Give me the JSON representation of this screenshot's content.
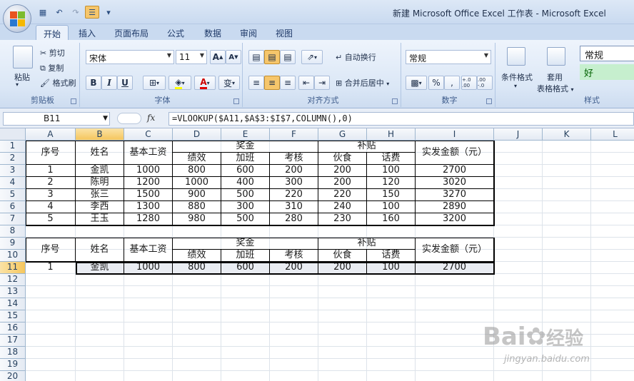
{
  "window": {
    "title": "新建 Microsoft Office Excel 工作表 - Microsoft Excel"
  },
  "tabs": [
    "开始",
    "插入",
    "页面布局",
    "公式",
    "数据",
    "审阅",
    "视图"
  ],
  "ribbon": {
    "clipboard": {
      "label": "剪贴板",
      "paste": "粘贴",
      "cut": "剪切",
      "copy": "复制",
      "format_painter": "格式刷"
    },
    "font": {
      "label": "字体",
      "name": "宋体",
      "size": "11",
      "bold": "B",
      "italic": "I",
      "underline": "U",
      "grow": "A",
      "shrink": "A",
      "font_color": "A",
      "phonetic": "变"
    },
    "alignment": {
      "label": "对齐方式",
      "wrap": "自动换行",
      "merge": "合并后居中"
    },
    "number": {
      "label": "数字",
      "format": "常规",
      "percent": "%",
      "comma": ",",
      "inc_decimal": "+.0 .00",
      "dec_decimal": ".00 -.0"
    },
    "styles": {
      "label": "样式",
      "conditional": "条件格式",
      "table_format_1": "套用",
      "table_format_2": "表格格式",
      "normal": "常规",
      "good": "好"
    },
    "colors": {
      "good_bg": "#c6efce",
      "good_fg": "#006100"
    }
  },
  "formula_bar": {
    "name_box": "B11",
    "fx": "fx",
    "formula": "=VLOOKUP($A11,$A$3:$I$7,COLUMN(),0)"
  },
  "columns": [
    "A",
    "B",
    "C",
    "D",
    "E",
    "F",
    "G",
    "H",
    "I",
    "J",
    "K",
    "L"
  ],
  "rows": [
    "1",
    "2",
    "3",
    "4",
    "5",
    "6",
    "7",
    "8",
    "9",
    "10",
    "11",
    "12",
    "13",
    "14",
    "15",
    "16",
    "17",
    "18",
    "19",
    "20"
  ],
  "table1": {
    "h_seq": "序号",
    "h_name": "姓名",
    "h_base": "基本工资",
    "h_bonus": "奖金",
    "h_perf": "绩效",
    "h_ot": "加班",
    "h_eval": "考核",
    "h_allow": "补贴",
    "h_meal": "伙食",
    "h_phone": "话费",
    "h_total": "实发金额（元）",
    "rows": [
      [
        "1",
        "金凯",
        "1000",
        "800",
        "600",
        "200",
        "200",
        "100",
        "2700"
      ],
      [
        "2",
        "陈明",
        "1200",
        "1000",
        "400",
        "300",
        "200",
        "120",
        "3020"
      ],
      [
        "3",
        "张三",
        "1500",
        "900",
        "500",
        "220",
        "220",
        "150",
        "3270"
      ],
      [
        "4",
        "李西",
        "1300",
        "880",
        "300",
        "310",
        "240",
        "100",
        "2890"
      ],
      [
        "5",
        "王玉",
        "1280",
        "980",
        "500",
        "280",
        "230",
        "160",
        "3200"
      ]
    ]
  },
  "table2": {
    "h_seq": "序号",
    "h_name": "姓名",
    "h_base": "基本工资",
    "h_bonus": "奖金",
    "h_perf": "绩效",
    "h_ot": "加班",
    "h_eval": "考核",
    "h_allow": "补贴",
    "h_meal": "伙食",
    "h_phone": "话费",
    "h_total": "实发金额（元）",
    "row": [
      "1",
      "金凯",
      "1000",
      "800",
      "600",
      "200",
      "200",
      "100",
      "2700"
    ]
  },
  "watermark": {
    "brand": "Bai",
    "brand2": "经验",
    "url": "jingyan.baidu.com"
  }
}
